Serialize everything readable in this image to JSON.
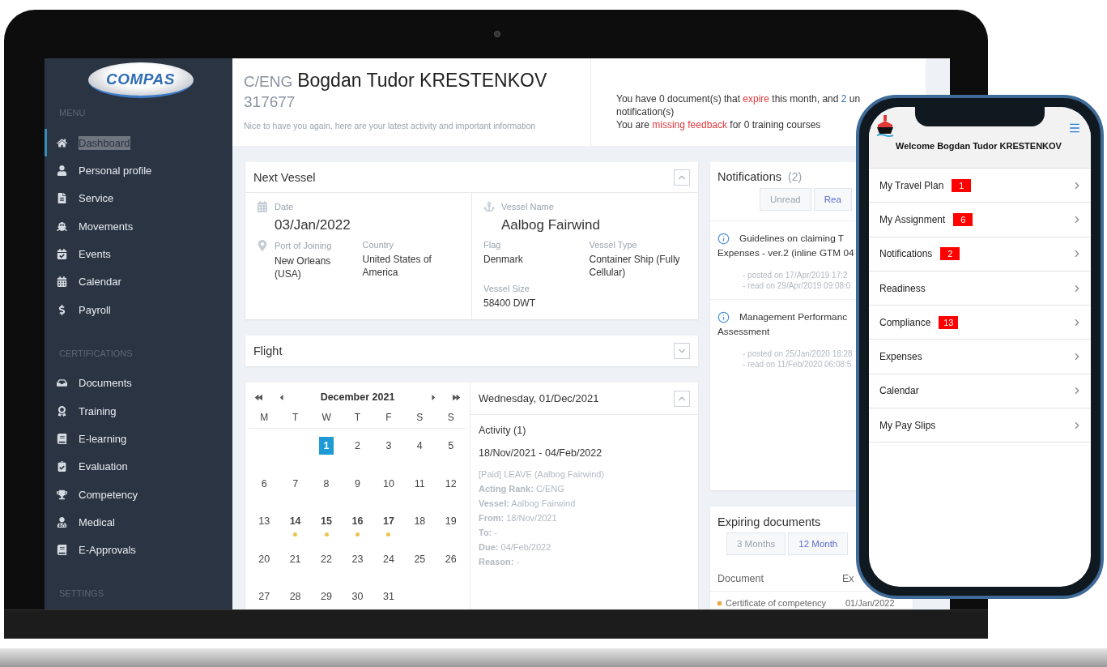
{
  "sidebar": {
    "logo": "COMPAS",
    "sections": [
      {
        "heading": "MENU",
        "items": [
          {
            "label": "Dashboard",
            "selected": true
          },
          {
            "label": "Personal profile",
            "selected": false
          },
          {
            "label": "Service",
            "selected": false
          },
          {
            "label": "Movements",
            "selected": false
          },
          {
            "label": "Events",
            "selected": false
          },
          {
            "label": "Calendar",
            "selected": false
          },
          {
            "label": "Payroll",
            "selected": false
          }
        ]
      },
      {
        "heading": "CERTIFICATIONS",
        "items": [
          {
            "label": "Documents",
            "selected": false
          },
          {
            "label": "Training",
            "selected": false
          },
          {
            "label": "E-learning",
            "selected": false
          },
          {
            "label": "Evaluation",
            "selected": false
          },
          {
            "label": "Competency",
            "selected": false
          },
          {
            "label": "Medical",
            "selected": false
          },
          {
            "label": "E-Approvals",
            "selected": false
          }
        ]
      },
      {
        "heading": "SETTINGS"
      }
    ]
  },
  "header": {
    "rank": "C/ENG",
    "name": "Bogdan Tudor KRESTENKOV",
    "id": "317677",
    "greeting": "Nice to have you again, here are your latest activity and important information",
    "notices": [
      [
        {
          "text": "You have 0 document(s) that ",
          "kind": "plain"
        },
        {
          "text": "expire",
          "kind": "alert"
        },
        {
          "text": " this month, and ",
          "kind": "plain"
        },
        {
          "text": "2",
          "kind": "link"
        },
        {
          "text": " un",
          "kind": "plain"
        }
      ],
      [
        {
          "text": "notification(s)",
          "kind": "plain"
        }
      ],
      [
        {
          "text": "You are ",
          "kind": "plain"
        },
        {
          "text": "missing feedback",
          "kind": "alert"
        },
        {
          "text": " for 0 training courses",
          "kind": "plain"
        }
      ]
    ]
  },
  "next_vessel": {
    "title": "Next Vessel",
    "expanded": true,
    "left": [
      {
        "label": "Date",
        "value": "03/Jan/2022",
        "kind": "big"
      },
      {
        "label": "Port of Joining",
        "value": "New Orleans (USA)",
        "kind": "pair"
      },
      {
        "label": "Country",
        "value": "United States of America",
        "kind": "pair"
      }
    ],
    "right": [
      {
        "label": "Vessel Name",
        "value": "Aalbog Fairwind",
        "kind": "big"
      },
      {
        "label": "Flag",
        "value": "Denmark",
        "kind": "pair"
      },
      {
        "label": "Vessel Type",
        "value": "Container Ship (Fully Cellular)",
        "kind": "pair"
      },
      {
        "label": "Vessel Size",
        "value": "58400 DWT",
        "kind": "pair"
      }
    ]
  },
  "flight": {
    "title": "Flight",
    "expanded": false
  },
  "calendar": {
    "month": "December 2021",
    "weekdays": [
      "M",
      "T",
      "W",
      "T",
      "F",
      "S",
      "S"
    ],
    "weeks": [
      [
        {
          "day": "1",
          "selected": true,
          "event": false
        },
        {
          "day": "2",
          "selected": false,
          "event": false
        },
        {
          "day": "3",
          "selected": false,
          "event": false
        },
        {
          "day": "4",
          "selected": false,
          "event": false
        },
        {
          "day": "5",
          "selected": false,
          "event": false
        }
      ],
      [
        {
          "day": "6",
          "selected": false,
          "event": false
        },
        {
          "day": "7",
          "selected": false,
          "event": false
        },
        {
          "day": "8",
          "selected": false,
          "event": false
        },
        {
          "day": "9",
          "selected": false,
          "event": false
        },
        {
          "day": "10",
          "selected": false,
          "event": false
        },
        {
          "day": "11",
          "selected": false,
          "event": false
        },
        {
          "day": "12",
          "selected": false,
          "event": false
        }
      ],
      [
        {
          "day": "13",
          "selected": false,
          "event": false
        },
        {
          "day": "14",
          "selected": false,
          "event": true
        },
        {
          "day": "15",
          "selected": false,
          "event": true
        },
        {
          "day": "16",
          "selected": false,
          "event": true
        },
        {
          "day": "17",
          "selected": false,
          "event": true
        },
        {
          "day": "18",
          "selected": false,
          "event": false
        },
        {
          "day": "19",
          "selected": false,
          "event": false
        }
      ],
      [
        {
          "day": "20",
          "selected": false,
          "event": false
        },
        {
          "day": "21",
          "selected": false,
          "event": false
        },
        {
          "day": "22",
          "selected": false,
          "event": false
        },
        {
          "day": "23",
          "selected": false,
          "event": false
        },
        {
          "day": "24",
          "selected": false,
          "event": false
        },
        {
          "day": "25",
          "selected": false,
          "event": false
        },
        {
          "day": "26",
          "selected": false,
          "event": false
        }
      ],
      [
        {
          "day": "27",
          "selected": false,
          "event": false
        },
        {
          "day": "28",
          "selected": false,
          "event": false
        },
        {
          "day": "29",
          "selected": false,
          "event": false
        },
        {
          "day": "30",
          "selected": false,
          "event": false
        },
        {
          "day": "31",
          "selected": false,
          "event": false
        }
      ]
    ]
  },
  "day_detail": {
    "title": "Wednesday, 01/Dec/2021",
    "expanded": true,
    "activity": "Activity (1)",
    "range": "18/Nov/2021 - 04/Feb/2022",
    "summary": "[Paid] LEAVE (Aalbog Fairwind)",
    "fields": [
      "**Acting Rank:** C/ENG",
      "**Vessel:** Aalbog Fairwind",
      "**From:** 18/Nov/2021",
      "**To:** -",
      "**Due:** 04/Feb/2022",
      "**Reason:** -"
    ]
  },
  "notifications": {
    "title": "Notifications",
    "count": "(2)",
    "tabs": [
      {
        "label": "Unread",
        "selected": false
      },
      {
        "label": "Rea",
        "selected": true
      }
    ],
    "items": [
      {
        "title_lines": [
          "Guidelines on claiming T",
          "Expenses - ver.2 (inline GTM 04"
        ],
        "meta": [
          "- posted on 17/Apr/2019 17:2",
          "- read on 29/Apr/2019 09:08:0"
        ]
      },
      {
        "title_lines": [
          "Management Performanc",
          "Assessment"
        ],
        "meta": [
          "- posted on 25/Jan/2020 18:28",
          "- read on 11/Feb/2020 06:08:5"
        ]
      }
    ]
  },
  "expiring": {
    "title": "Expiring documents",
    "tabs": [
      {
        "label": "3 Months",
        "selected": false
      },
      {
        "label": "12 Month",
        "selected": true
      }
    ],
    "columns": [
      "Document",
      "Ex"
    ],
    "rows": [
      [
        "Certificate of competency",
        "01/Jan/2022"
      ]
    ]
  },
  "phone": {
    "welcome": "Welcome Bogdan Tudor KRESTENKOV",
    "items": [
      {
        "label": "My Travel Plan",
        "badge": "1"
      },
      {
        "label": "My Assignment",
        "badge": "6"
      },
      {
        "label": "Notifications",
        "badge": "2"
      },
      {
        "label": "Readiness"
      },
      {
        "label": "Compliance",
        "badge": "13"
      },
      {
        "label": "Expenses"
      },
      {
        "label": "Calendar"
      },
      {
        "label": "My Pay Slips"
      }
    ]
  }
}
